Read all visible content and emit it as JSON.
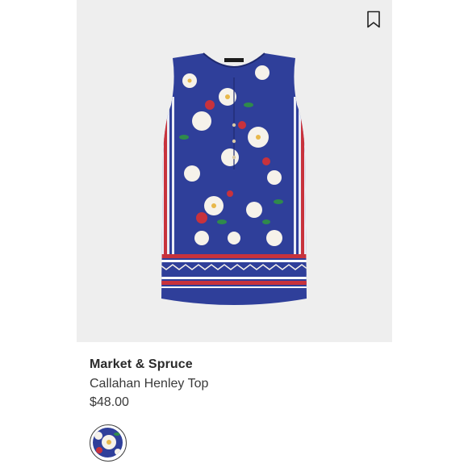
{
  "product": {
    "brand": "Market & Spruce",
    "name": "Callahan Henley Top",
    "price": "$48.00"
  },
  "actions": {
    "bookmark_icon": "bookmark-icon"
  },
  "colors": {
    "card_background": "#eeeeee",
    "garment_blue": "#2f3f9a",
    "border_red": "#c8323c",
    "flower_white": "#f6f2ea"
  },
  "swatches": [
    {
      "icon": "floral-print-swatch",
      "selected": true
    }
  ]
}
